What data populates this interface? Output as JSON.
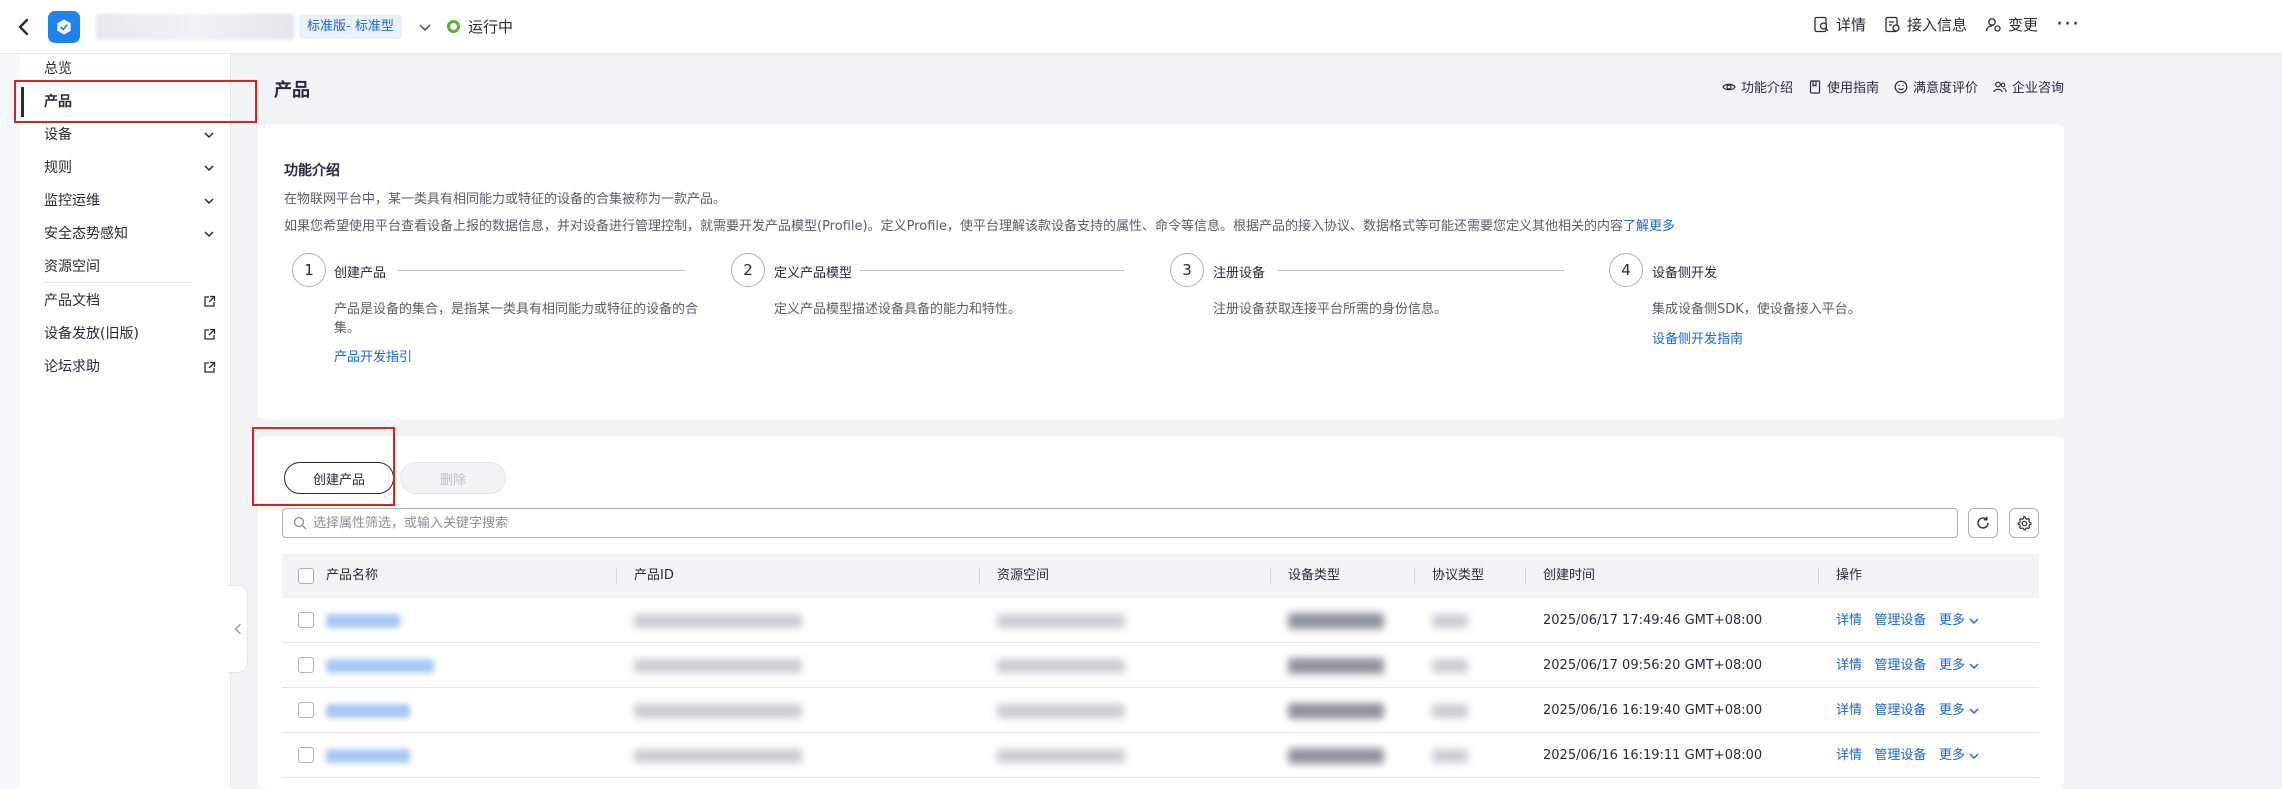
{
  "topbar": {
    "edition": "标准版- 标准型",
    "status": "运行中",
    "actions": [
      {
        "label": "详情",
        "icon": "detail-icon"
      },
      {
        "label": "接入信息",
        "icon": "access-info-icon"
      },
      {
        "label": "变更",
        "icon": "change-icon"
      }
    ],
    "more": "···"
  },
  "sidebar": {
    "items": [
      {
        "label": "总览"
      },
      {
        "label": "产品",
        "active": true
      },
      {
        "label": "设备",
        "expandable": true
      },
      {
        "label": "规则",
        "expandable": true
      },
      {
        "label": "监控运维",
        "expandable": true
      },
      {
        "label": "安全态势感知",
        "expandable": true
      },
      {
        "label": "资源空间"
      },
      {
        "label": "产品文档",
        "external": true
      },
      {
        "label": "设备发放(旧版)",
        "external": true
      },
      {
        "label": "论坛求助",
        "external": true
      }
    ]
  },
  "page": {
    "title": "产品",
    "links": [
      "功能介绍",
      "使用指南",
      "满意度评价",
      "企业咨询"
    ]
  },
  "intro": {
    "title": "功能介绍",
    "line1": "在物联网平台中，某一类具有相同能力或特征的设备的合集被称为一款产品。",
    "line2": "如果您希望使用平台查看设备上报的数据信息，并对设备进行管理控制，就需要开发产品模型(Profile)。定义Profile，使平台理解该款设备支持的属性、命令等信息。根据产品的接入协议、数据格式等可能还需要您定义其他相关的内容",
    "learn_more": "了解更多",
    "steps": [
      {
        "num": "1",
        "title": "创建产品",
        "desc": "产品是设备的集合，是指某一类具有相同能力或特征的设备的合集。",
        "link": "产品开发指引"
      },
      {
        "num": "2",
        "title": "定义产品模型",
        "desc": "定义产品模型描述设备具备的能力和特性。",
        "link": ""
      },
      {
        "num": "3",
        "title": "注册设备",
        "desc": "注册设备获取连接平台所需的身份信息。",
        "link": ""
      },
      {
        "num": "4",
        "title": "设备侧开发",
        "desc": "集成设备侧SDK，使设备接入平台。",
        "link": "设备侧开发指南"
      }
    ]
  },
  "list": {
    "create_label": "创建产品",
    "delete_label": "删除",
    "search_placeholder": "选择属性筛选，或输入关键字搜索",
    "columns": [
      "产品名称",
      "产品ID",
      "资源空间",
      "设备类型",
      "协议类型",
      "创建时间",
      "操作"
    ],
    "rows": [
      {
        "created": "2025/06/17 17:49:46 GMT+08:00"
      },
      {
        "created": "2025/06/17 09:56:20 GMT+08:00"
      },
      {
        "created": "2025/06/16 16:19:40 GMT+08:00"
      },
      {
        "created": "2025/06/16 16:19:11 GMT+08:00"
      }
    ],
    "ops": {
      "detail": "详情",
      "manage": "管理设备",
      "more": "更多"
    }
  },
  "colors": {
    "accent": "#1867d2",
    "status_ok": "#50b432",
    "highlight": "#e02020"
  }
}
